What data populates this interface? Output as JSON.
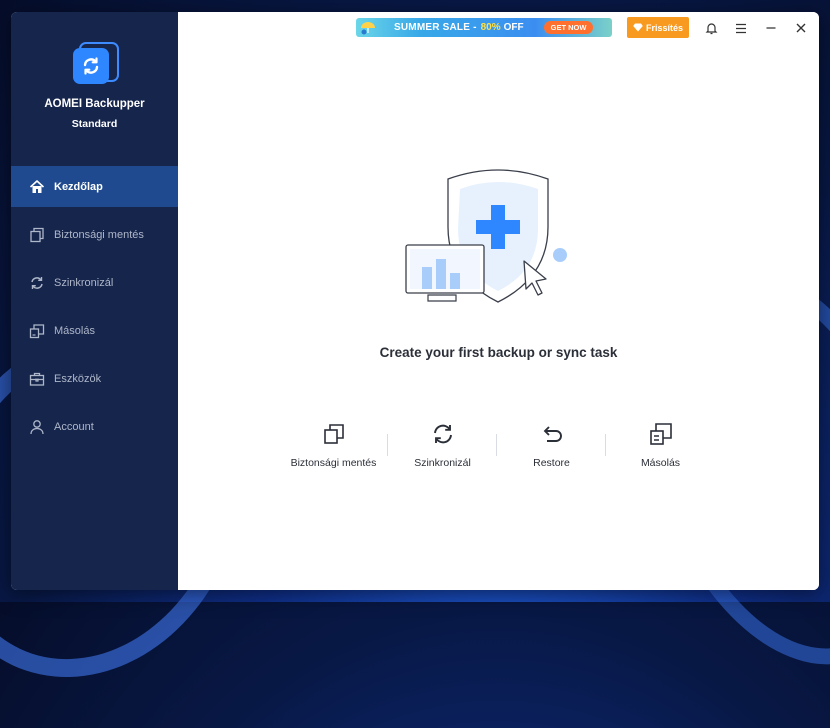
{
  "app": {
    "name": "AOMEI Backupper",
    "edition": "Standard"
  },
  "sidebar": {
    "items": [
      {
        "label": "Kezdőlap",
        "icon": "home-icon",
        "active": true
      },
      {
        "label": "Biztonsági mentés",
        "icon": "backup-icon",
        "active": false
      },
      {
        "label": "Szinkronizál",
        "icon": "sync-icon",
        "active": false
      },
      {
        "label": "Másolás",
        "icon": "clone-icon",
        "active": false
      },
      {
        "label": "Eszközök",
        "icon": "toolbox-icon",
        "active": false
      },
      {
        "label": "Account",
        "icon": "user-icon",
        "active": false
      }
    ]
  },
  "topbar": {
    "promo": {
      "sale": "SUMMER SALE -",
      "percent": "80%",
      "off": "OFF",
      "cta": "GET NOW"
    },
    "upgrade_label": "Frissítés",
    "icons": [
      "bell-icon",
      "menu-icon",
      "minimize-icon",
      "close-icon"
    ]
  },
  "main": {
    "headline": "Create your first backup or sync task",
    "actions": [
      {
        "label": "Biztonsági mentés",
        "icon": "backup-icon"
      },
      {
        "label": "Szinkronizál",
        "icon": "sync-icon"
      },
      {
        "label": "Restore",
        "icon": "restore-icon"
      },
      {
        "label": "Másolás",
        "icon": "clone-icon"
      }
    ]
  },
  "colors": {
    "sidebar_bg": "#16254c",
    "active_bg": "#1f4a8f",
    "accent": "#2f87ff",
    "upgrade": "#f79a1f"
  }
}
